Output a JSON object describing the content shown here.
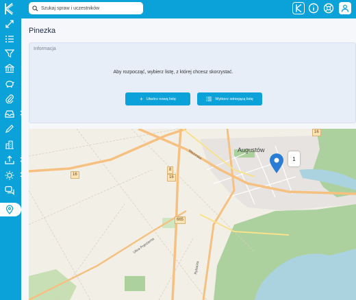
{
  "search": {
    "placeholder": "Szukaj spraw i uczestników"
  },
  "page": {
    "title": "Pinezka"
  },
  "info": {
    "label": "Informacja",
    "message": "Aby rozpocząć,  wybierz listę, z której chcesz skorzystać.",
    "new_list_button": "Utwórz nową listę",
    "existing_list_button": "Wybierz istniejącą listę"
  },
  "map": {
    "city_label": "Augustów",
    "cluster_count": "1",
    "road_labels": [
      "16",
      "8",
      "16",
      "665",
      "16"
    ],
    "street_labels": [
      "Mazurska",
      "Ulica Pojezierna",
      "Rybacka"
    ]
  },
  "sidebar": {
    "items": [
      "expand-icon",
      "list-icon",
      "filter-icon",
      "bank-icon",
      "piggy-bank-icon",
      "paperclip-icon",
      "inbox-icon",
      "pencil-icon",
      "buildings-icon",
      "upload-icon",
      "sun-icon",
      "chat-icon",
      "map-pin-icon"
    ],
    "active": "map-pin-icon"
  },
  "colors": {
    "brand": "#0aa2d8",
    "marker": "#2b7cd3",
    "water": "#aad3df",
    "forest": "#add19e"
  }
}
